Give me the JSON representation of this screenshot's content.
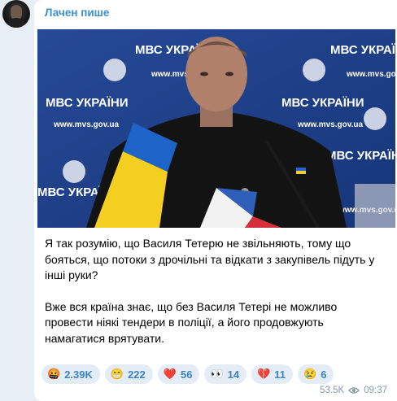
{
  "channel": {
    "name": "Лачен пише"
  },
  "post": {
    "paragraphs": [
      "Я так розумію, що Василя Тетерю не звільняють, тому що бояться, що потоки з дрочільні та відкати з закупівель підуть у інші руки?",
      "Вже вся країна знає, що без Василя Тетері не можливо провести ніякі тендери в поліції, а його продовжують намагатися врятувати."
    ],
    "photo_backdrop_text": {
      "brand": "МВС УКРАЇНИ",
      "site": "www.mvs.gov.ua"
    }
  },
  "reactions": [
    {
      "icon": "angry-face-icon",
      "emoji": "🤬",
      "count": "2.39K"
    },
    {
      "icon": "grinning-face-icon",
      "emoji": "😁",
      "count": "222"
    },
    {
      "icon": "red-heart-icon",
      "emoji": "❤️",
      "count": "56"
    },
    {
      "icon": "eyes-icon",
      "emoji": "👀",
      "count": "14"
    },
    {
      "icon": "broken-heart-icon",
      "emoji": "💔",
      "count": "11"
    },
    {
      "icon": "crying-face-icon",
      "emoji": "😢",
      "count": "6"
    }
  ],
  "meta": {
    "views": "53.5K",
    "time": "09:37"
  },
  "colors": {
    "accent": "#3a8fd1",
    "reaction_bg": "#e4edf5",
    "meta": "#8a98a6",
    "backdrop": "#1f3f86"
  }
}
